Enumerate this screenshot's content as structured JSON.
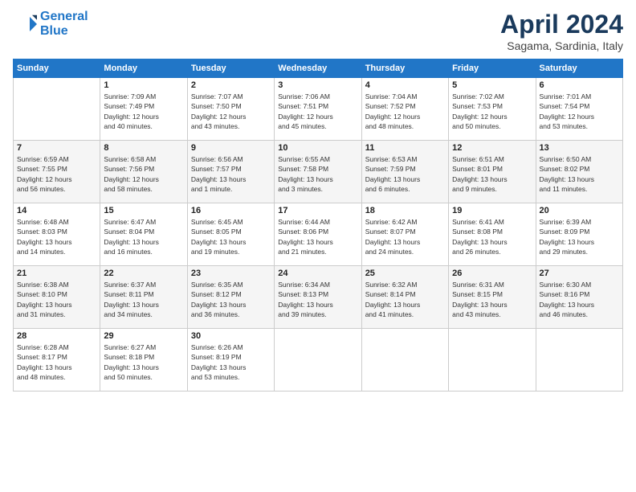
{
  "header": {
    "logo_line1": "General",
    "logo_line2": "Blue",
    "month": "April 2024",
    "location": "Sagama, Sardinia, Italy"
  },
  "weekdays": [
    "Sunday",
    "Monday",
    "Tuesday",
    "Wednesday",
    "Thursday",
    "Friday",
    "Saturday"
  ],
  "weeks": [
    [
      {
        "day": "",
        "info": ""
      },
      {
        "day": "1",
        "info": "Sunrise: 7:09 AM\nSunset: 7:49 PM\nDaylight: 12 hours\nand 40 minutes."
      },
      {
        "day": "2",
        "info": "Sunrise: 7:07 AM\nSunset: 7:50 PM\nDaylight: 12 hours\nand 43 minutes."
      },
      {
        "day": "3",
        "info": "Sunrise: 7:06 AM\nSunset: 7:51 PM\nDaylight: 12 hours\nand 45 minutes."
      },
      {
        "day": "4",
        "info": "Sunrise: 7:04 AM\nSunset: 7:52 PM\nDaylight: 12 hours\nand 48 minutes."
      },
      {
        "day": "5",
        "info": "Sunrise: 7:02 AM\nSunset: 7:53 PM\nDaylight: 12 hours\nand 50 minutes."
      },
      {
        "day": "6",
        "info": "Sunrise: 7:01 AM\nSunset: 7:54 PM\nDaylight: 12 hours\nand 53 minutes."
      }
    ],
    [
      {
        "day": "7",
        "info": "Sunrise: 6:59 AM\nSunset: 7:55 PM\nDaylight: 12 hours\nand 56 minutes."
      },
      {
        "day": "8",
        "info": "Sunrise: 6:58 AM\nSunset: 7:56 PM\nDaylight: 12 hours\nand 58 minutes."
      },
      {
        "day": "9",
        "info": "Sunrise: 6:56 AM\nSunset: 7:57 PM\nDaylight: 13 hours\nand 1 minute."
      },
      {
        "day": "10",
        "info": "Sunrise: 6:55 AM\nSunset: 7:58 PM\nDaylight: 13 hours\nand 3 minutes."
      },
      {
        "day": "11",
        "info": "Sunrise: 6:53 AM\nSunset: 7:59 PM\nDaylight: 13 hours\nand 6 minutes."
      },
      {
        "day": "12",
        "info": "Sunrise: 6:51 AM\nSunset: 8:01 PM\nDaylight: 13 hours\nand 9 minutes."
      },
      {
        "day": "13",
        "info": "Sunrise: 6:50 AM\nSunset: 8:02 PM\nDaylight: 13 hours\nand 11 minutes."
      }
    ],
    [
      {
        "day": "14",
        "info": "Sunrise: 6:48 AM\nSunset: 8:03 PM\nDaylight: 13 hours\nand 14 minutes."
      },
      {
        "day": "15",
        "info": "Sunrise: 6:47 AM\nSunset: 8:04 PM\nDaylight: 13 hours\nand 16 minutes."
      },
      {
        "day": "16",
        "info": "Sunrise: 6:45 AM\nSunset: 8:05 PM\nDaylight: 13 hours\nand 19 minutes."
      },
      {
        "day": "17",
        "info": "Sunrise: 6:44 AM\nSunset: 8:06 PM\nDaylight: 13 hours\nand 21 minutes."
      },
      {
        "day": "18",
        "info": "Sunrise: 6:42 AM\nSunset: 8:07 PM\nDaylight: 13 hours\nand 24 minutes."
      },
      {
        "day": "19",
        "info": "Sunrise: 6:41 AM\nSunset: 8:08 PM\nDaylight: 13 hours\nand 26 minutes."
      },
      {
        "day": "20",
        "info": "Sunrise: 6:39 AM\nSunset: 8:09 PM\nDaylight: 13 hours\nand 29 minutes."
      }
    ],
    [
      {
        "day": "21",
        "info": "Sunrise: 6:38 AM\nSunset: 8:10 PM\nDaylight: 13 hours\nand 31 minutes."
      },
      {
        "day": "22",
        "info": "Sunrise: 6:37 AM\nSunset: 8:11 PM\nDaylight: 13 hours\nand 34 minutes."
      },
      {
        "day": "23",
        "info": "Sunrise: 6:35 AM\nSunset: 8:12 PM\nDaylight: 13 hours\nand 36 minutes."
      },
      {
        "day": "24",
        "info": "Sunrise: 6:34 AM\nSunset: 8:13 PM\nDaylight: 13 hours\nand 39 minutes."
      },
      {
        "day": "25",
        "info": "Sunrise: 6:32 AM\nSunset: 8:14 PM\nDaylight: 13 hours\nand 41 minutes."
      },
      {
        "day": "26",
        "info": "Sunrise: 6:31 AM\nSunset: 8:15 PM\nDaylight: 13 hours\nand 43 minutes."
      },
      {
        "day": "27",
        "info": "Sunrise: 6:30 AM\nSunset: 8:16 PM\nDaylight: 13 hours\nand 46 minutes."
      }
    ],
    [
      {
        "day": "28",
        "info": "Sunrise: 6:28 AM\nSunset: 8:17 PM\nDaylight: 13 hours\nand 48 minutes."
      },
      {
        "day": "29",
        "info": "Sunrise: 6:27 AM\nSunset: 8:18 PM\nDaylight: 13 hours\nand 50 minutes."
      },
      {
        "day": "30",
        "info": "Sunrise: 6:26 AM\nSunset: 8:19 PM\nDaylight: 13 hours\nand 53 minutes."
      },
      {
        "day": "",
        "info": ""
      },
      {
        "day": "",
        "info": ""
      },
      {
        "day": "",
        "info": ""
      },
      {
        "day": "",
        "info": ""
      }
    ]
  ]
}
